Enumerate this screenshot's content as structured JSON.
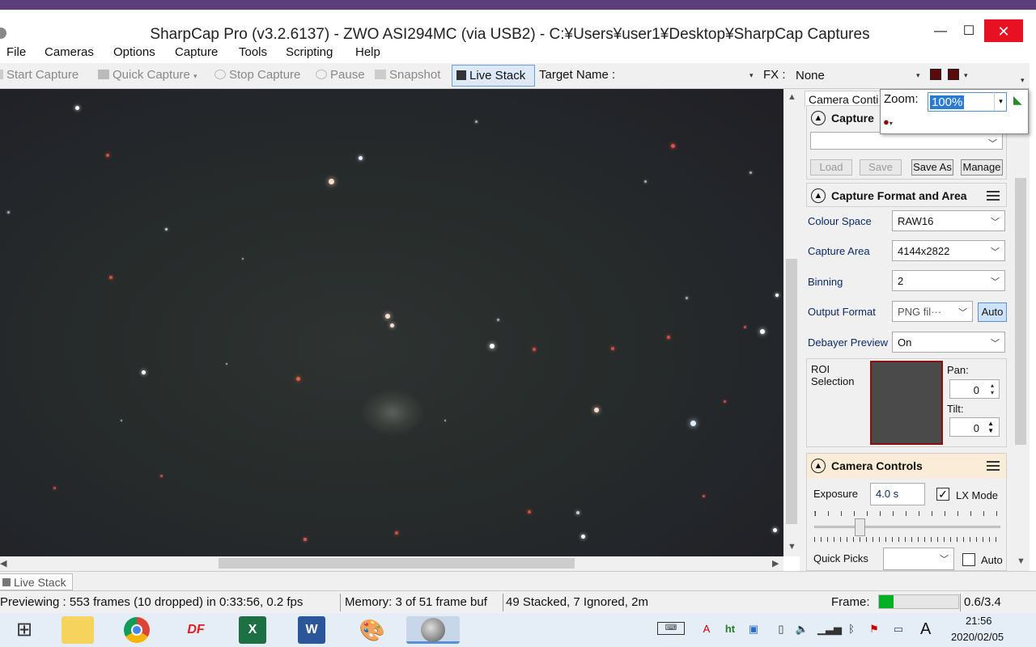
{
  "window": {
    "title": "SharpCap Pro (v3.2.6137) - ZWO ASI294MC (via USB2) - C:¥Users¥user1¥Desktop¥SharpCap Captures",
    "minimize": "—",
    "maximize": "☐",
    "close": "✕"
  },
  "menu": [
    "File",
    "Cameras",
    "Options",
    "Capture",
    "Tools",
    "Scripting",
    "Help"
  ],
  "toolbar": {
    "start_capture": "Start Capture",
    "quick_capture": "Quick Capture",
    "stop_capture": "Stop Capture",
    "pause": "Pause",
    "snapshot": "Snapshot",
    "live_stack": "Live Stack",
    "target_name_label": "Target Name :",
    "target_name_value": "",
    "fx_label": "FX :",
    "fx_value": "None"
  },
  "zoom": {
    "label": "Zoom:",
    "value": "100%"
  },
  "panel": {
    "tab": "Camera Conti",
    "capture_profiles": {
      "title": "Capture",
      "profile_value": "",
      "load": "Load",
      "save": "Save",
      "save_as": "Save As",
      "manage": "Manage"
    },
    "format": {
      "title": "Capture Format and Area",
      "colour_space_label": "Colour Space",
      "colour_space_value": "RAW16",
      "capture_area_label": "Capture Area",
      "capture_area_value": "4144x2822",
      "binning_label": "Binning",
      "binning_value": "2",
      "output_format_label": "Output Format",
      "output_format_value": "PNG fil···",
      "output_format_auto": "Auto",
      "debayer_label": "Debayer Preview",
      "debayer_value": "On",
      "roi_label": "ROI Selection",
      "pan_label": "Pan:",
      "pan_value": "0",
      "tilt_label": "Tilt:",
      "tilt_value": "0"
    },
    "camera_controls": {
      "title": "Camera Controls",
      "exposure_label": "Exposure",
      "exposure_value": "4.0 s",
      "lx_mode_label": "LX Mode",
      "lx_mode_checked": true,
      "quick_picks_label": "Quick Picks",
      "quick_picks_value": "",
      "auto_label": "Auto"
    }
  },
  "bottom_tab": "Live Stack",
  "status": {
    "previewing": "Previewing : 553 frames (10 dropped) in 0:33:56, 0.2 fps",
    "memory": "Memory: 3 of 51 frame buf",
    "stacked": "49 Stacked, 7 Ignored, 2m",
    "frame_label": "Frame:",
    "frame_value": "0.6/3.4",
    "frame_progress": 0.18
  },
  "taskbar": {
    "time": "21:56",
    "date": "2020/02/05",
    "ime": "A",
    "apps": [
      "windows-start",
      "file-explorer",
      "chrome",
      "df-app",
      "excel",
      "word",
      "paint",
      "sharpcap"
    ]
  },
  "colors": {
    "accent": "#2a7ad6",
    "close_red": "#e81123",
    "frame_green": "#06b025",
    "group_header_warm": "#fbecd8"
  }
}
